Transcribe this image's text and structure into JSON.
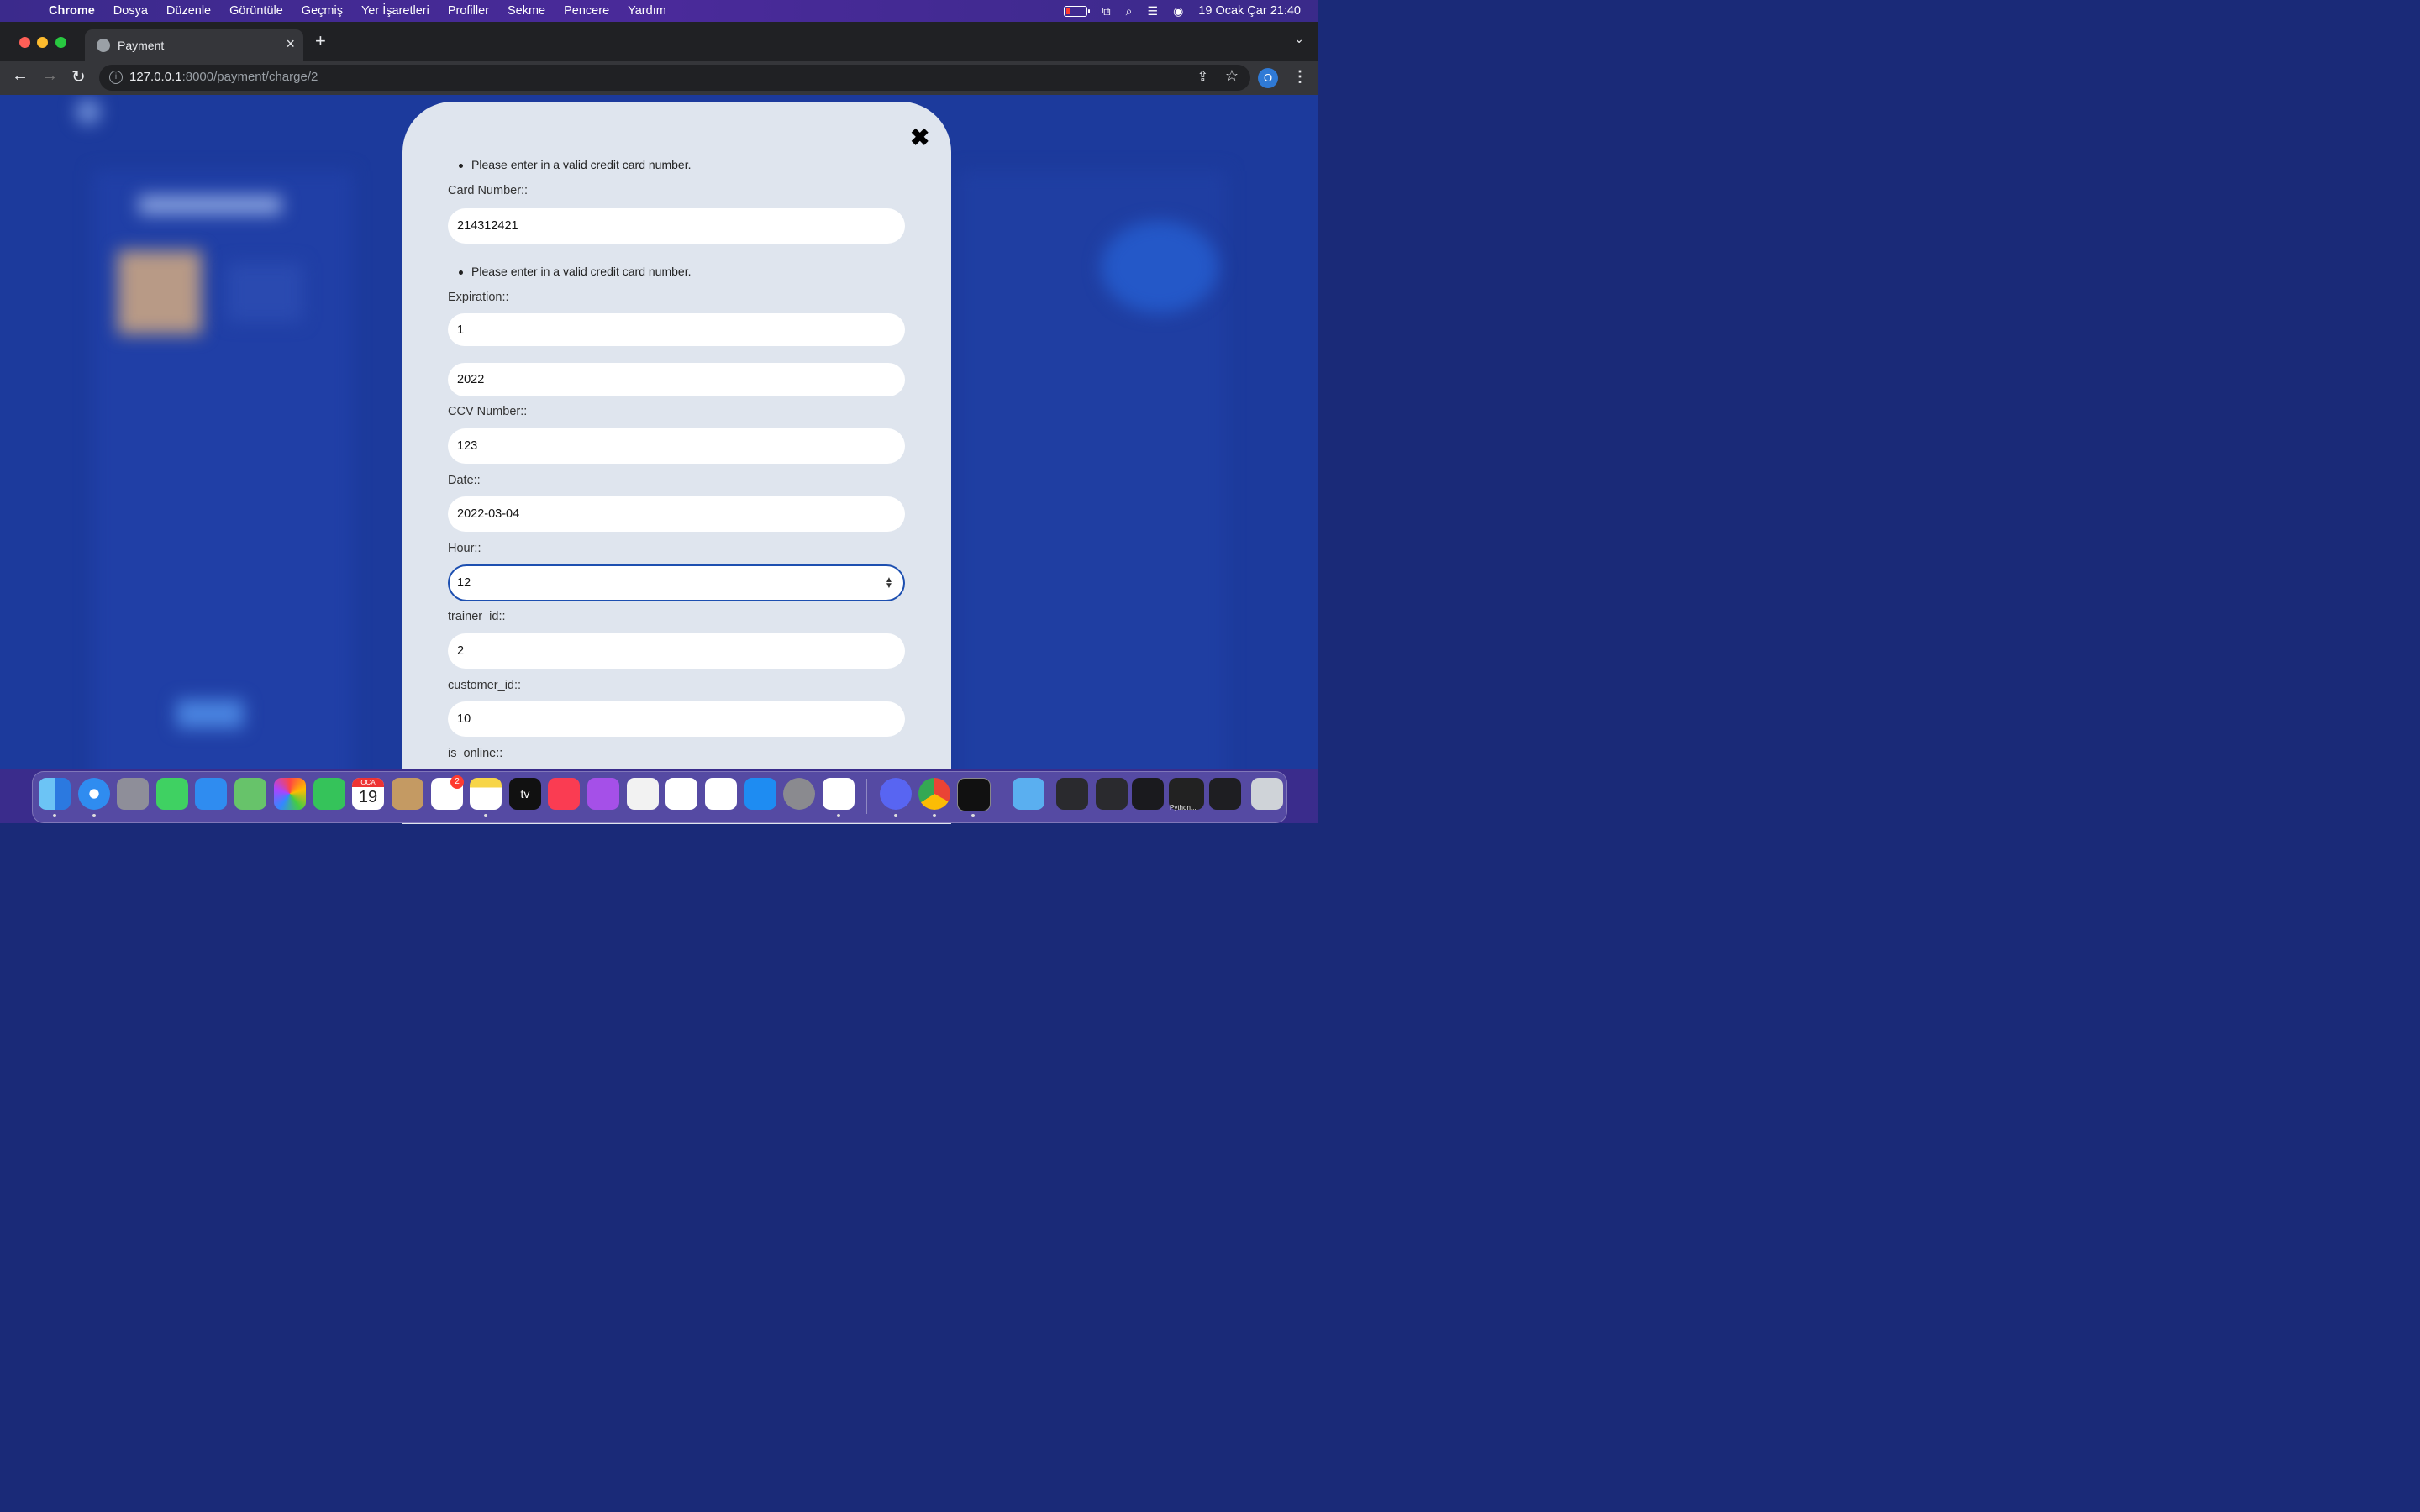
{
  "menubar": {
    "app": "Chrome",
    "items": [
      "Dosya",
      "Düzenle",
      "Görüntüle",
      "Geçmiş",
      "Yer İşaretleri",
      "Profiller",
      "Sekme",
      "Pencere",
      "Yardım"
    ],
    "datetime": "19 Ocak Çar  21:40"
  },
  "browser": {
    "tab_title": "Payment",
    "url_host": "127.0.0.1",
    "url_rest": ":8000/payment/charge/2",
    "profile_initial": "O"
  },
  "form": {
    "close_symbol": "✖",
    "errors": [
      "Please enter in a valid credit card number.",
      "Please enter in a valid credit card number."
    ],
    "fields": [
      {
        "label": "Card Number::",
        "value": "214312421"
      },
      {
        "label": "Expiration::",
        "value": "1"
      },
      {
        "label": "",
        "value": "2022"
      },
      {
        "label": "CCV Number::",
        "value": "123"
      },
      {
        "label": "Date::",
        "value": "2022-03-04"
      },
      {
        "label": "Hour::",
        "value": "12"
      },
      {
        "label": "trainer_id::",
        "value": "2"
      },
      {
        "label": "customer_id::",
        "value": "10"
      },
      {
        "label": "is_online::",
        "value": ""
      }
    ]
  },
  "dock": {
    "calendar_month": "OCA",
    "calendar_day": "19",
    "reminders_badge": "2",
    "tv_label": "tv",
    "window_thumb_label": "Python..."
  },
  "colors": {
    "modal_bg": "#dfe5ee",
    "focus_border": "#1d4fb0",
    "page_bg": "#1c3a9c"
  }
}
